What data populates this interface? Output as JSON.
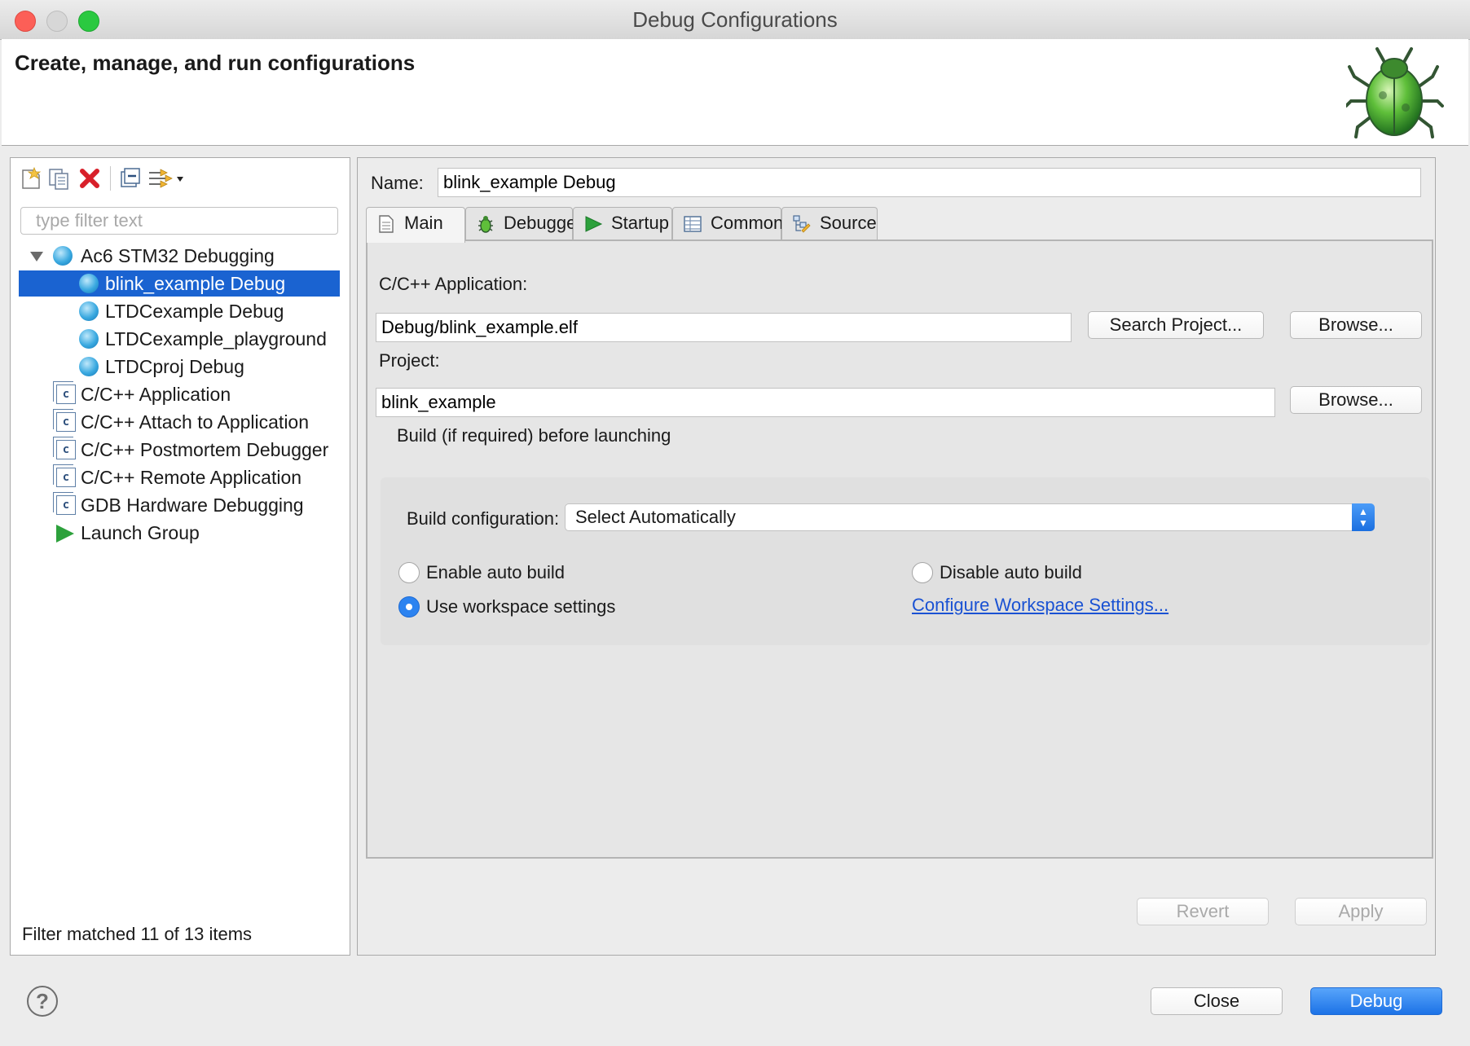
{
  "window": {
    "title": "Debug Configurations"
  },
  "header": {
    "title": "Create, manage, and run configurations",
    "icon": "bug-icon"
  },
  "left_panel": {
    "toolbar": {
      "icons": [
        "new-configuration-icon",
        "duplicate-icon",
        "delete-icon",
        "collapse-all-icon",
        "filter-icon"
      ]
    },
    "filter": {
      "placeholder": "type filter text",
      "value": ""
    },
    "tree": [
      {
        "label": "Ac6 STM32 Debugging",
        "type": "category",
        "expanded": true
      },
      {
        "label": "blink_example Debug",
        "type": "item",
        "selected": true
      },
      {
        "label": "LTDCexample Debug",
        "type": "item"
      },
      {
        "label": "LTDCexample_playground",
        "type": "item"
      },
      {
        "label": "LTDCproj Debug",
        "type": "item"
      },
      {
        "label": "C/C++ Application",
        "type": "category"
      },
      {
        "label": "C/C++ Attach to Application",
        "type": "category"
      },
      {
        "label": "C/C++ Postmortem Debugger",
        "type": "category"
      },
      {
        "label": "C/C++ Remote Application",
        "type": "category"
      },
      {
        "label": "GDB Hardware Debugging",
        "type": "category"
      },
      {
        "label": "Launch Group",
        "type": "category"
      }
    ],
    "status": "Filter matched 11 of 13 items"
  },
  "right_panel": {
    "name_label": "Name:",
    "name_value": "blink_example Debug",
    "tabs": [
      {
        "label": "Main",
        "active": true,
        "icon": "document-icon"
      },
      {
        "label": "Debugger",
        "icon": "bug-icon"
      },
      {
        "label": "Startup",
        "icon": "play-icon"
      },
      {
        "label": "Common",
        "icon": "table-icon"
      },
      {
        "label": "Source",
        "icon": "source-tree-icon"
      }
    ],
    "main": {
      "app_label": "C/C++ Application:",
      "app_value": "Debug/blink_example.elf",
      "search_project_label": "Search Project...",
      "browse_label": "Browse...",
      "project_label": "Project:",
      "project_value": "blink_example",
      "build_group_title": "Build (if required) before launching",
      "build_config_label": "Build configuration:",
      "build_config_value": "Select Automatically",
      "enable_auto_build": "Enable auto build",
      "disable_auto_build": "Disable auto build",
      "use_workspace": "Use workspace settings",
      "configure_link": "Configure Workspace Settings...",
      "selected_option": "Use workspace settings"
    },
    "revert_label": "Revert",
    "apply_label": "Apply"
  },
  "footer": {
    "close_label": "Close",
    "debug_label": "Debug",
    "help_icon": "help-icon"
  },
  "colors": {
    "accent": "#1a63d1",
    "link": "#1a52d3",
    "primary_button": "#2c83f0"
  }
}
